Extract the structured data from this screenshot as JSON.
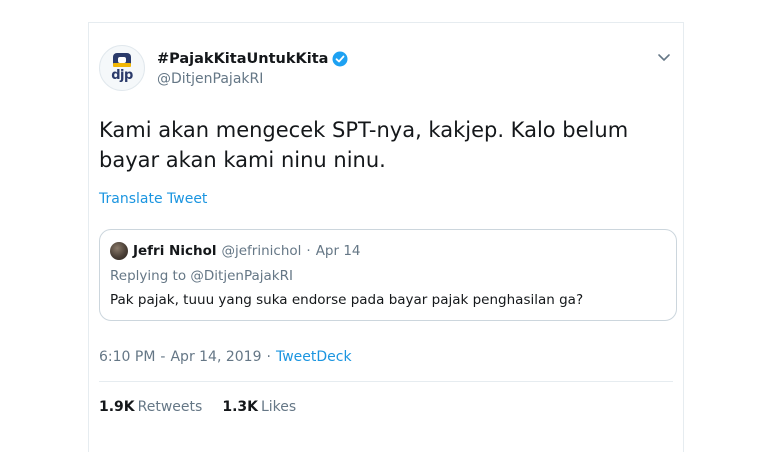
{
  "tweet": {
    "author": {
      "display_name": "#PajakKitaUntukKita",
      "handle": "@DitjenPajakRI",
      "avatar_text": "djp",
      "verified": true
    },
    "text": "Kami akan mengecek SPT-nya, kakjep. Kalo belum bayar akan kami ninu ninu.",
    "translate_label": "Translate Tweet",
    "quoted": {
      "display_name": "Jefri Nichol",
      "handle": "@jefrinichol",
      "separator": "·",
      "date": "Apr 14",
      "replying_prefix": "Replying to",
      "replying_to": "@DitjenPajakRI",
      "text": "Pak pajak, tuuu yang suka endorse pada bayar pajak penghasilan ga?"
    },
    "meta": {
      "time": "6:10 PM",
      "separator1": "-",
      "date": "Apr 14, 2019",
      "separator2": "·",
      "source": "TweetDeck"
    },
    "stats": {
      "retweets_count": "1.9K",
      "retweets_label": "Retweets",
      "likes_count": "1.3K",
      "likes_label": "Likes"
    }
  },
  "colors": {
    "link": "#1b95e0",
    "muted": "#657786",
    "text": "#14171a",
    "verified": "#1da1f2",
    "border": "#ccd6dd"
  },
  "icons": {
    "verified": "verified-badge-icon",
    "caret": "chevron-down-icon"
  }
}
